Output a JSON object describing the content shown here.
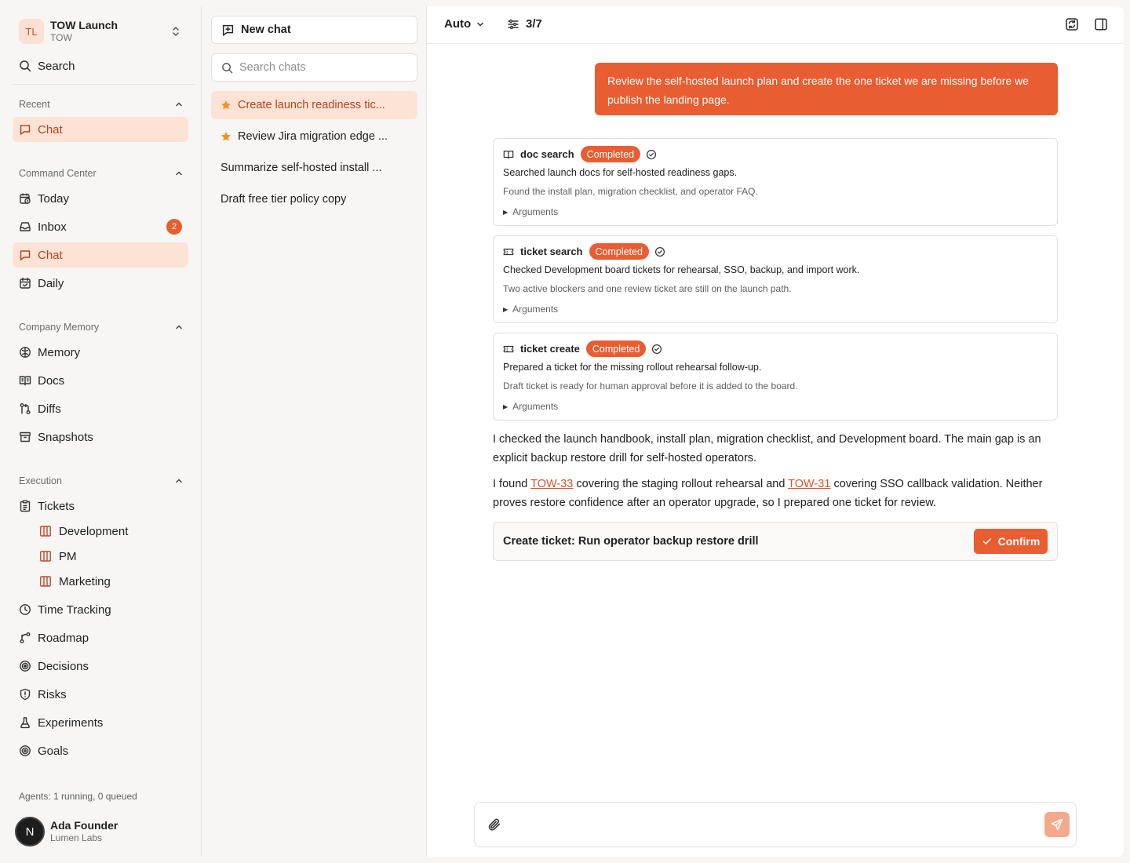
{
  "colors": {
    "accent": "#e85d31",
    "accent_soft": "#fde3d6",
    "accent_text": "#b2451d",
    "background": "#f7f6f5"
  },
  "workspace": {
    "initials": "TL",
    "name": "TOW Launch",
    "key": "TOW"
  },
  "sidebar": {
    "search_label": "Search",
    "sections": {
      "recent": {
        "title": "Recent",
        "items": [
          {
            "label": "Chat",
            "icon": "message-square-icon",
            "active": true
          }
        ]
      },
      "command_center": {
        "title": "Command Center",
        "items": [
          {
            "label": "Today",
            "icon": "calendar-clock-icon"
          },
          {
            "label": "Inbox",
            "icon": "inbox-icon",
            "badge": "2"
          },
          {
            "label": "Chat",
            "icon": "message-square-icon",
            "active": true
          },
          {
            "label": "Daily",
            "icon": "calendar-check-icon"
          }
        ]
      },
      "company_memory": {
        "title": "Company Memory",
        "items": [
          {
            "label": "Memory",
            "icon": "brain-icon"
          },
          {
            "label": "Docs",
            "icon": "book-open-icon"
          },
          {
            "label": "Diffs",
            "icon": "git-compare-icon"
          },
          {
            "label": "Snapshots",
            "icon": "archive-icon"
          }
        ]
      },
      "execution": {
        "title": "Execution",
        "items": [
          {
            "label": "Tickets",
            "icon": "clipboard-list-icon"
          },
          {
            "label": "Development",
            "icon": "board-icon",
            "sub": true
          },
          {
            "label": "PM",
            "icon": "board-icon",
            "sub": true
          },
          {
            "label": "Marketing",
            "icon": "board-icon",
            "sub": true
          },
          {
            "label": "Time Tracking",
            "icon": "clock-icon"
          },
          {
            "label": "Roadmap",
            "icon": "route-icon"
          },
          {
            "label": "Decisions",
            "icon": "target-icon"
          },
          {
            "label": "Risks",
            "icon": "shield-alert-icon"
          },
          {
            "label": "Experiments",
            "icon": "flask-icon"
          },
          {
            "label": "Goals",
            "icon": "goal-icon"
          }
        ]
      }
    },
    "agents_status": "Agents: 1 running, 0 queued",
    "user": {
      "initial": "N",
      "name": "Ada Founder",
      "org": "Lumen Labs"
    }
  },
  "chat_list": {
    "new_chat_label": "New chat",
    "search_placeholder": "Search chats",
    "conversations": [
      {
        "title": "Create launch readiness tic...",
        "starred": true,
        "active": true
      },
      {
        "title": "Review Jira migration edge ...",
        "starred": true,
        "active": false
      },
      {
        "title": "Summarize self-hosted install ...",
        "starred": false,
        "active": false
      },
      {
        "title": "Draft free tier policy copy",
        "starred": false,
        "active": false
      }
    ]
  },
  "main": {
    "model_label": "Auto",
    "steps_label": "3/7",
    "user_message": "Review the self-hosted launch plan and create the one ticket we are missing before we publish the landing page.",
    "tool_calls": [
      {
        "name": "doc search",
        "icon": "book-open-icon",
        "status": "Completed",
        "summary": "Searched launch docs for self-hosted readiness gaps.",
        "detail": "Found the install plan, migration checklist, and operator FAQ.",
        "args_label": "Arguments"
      },
      {
        "name": "ticket search",
        "icon": "ticket-icon",
        "status": "Completed",
        "summary": "Checked Development board tickets for rehearsal, SSO, backup, and import work.",
        "detail": "Two active blockers and one review ticket are still on the launch path.",
        "args_label": "Arguments"
      },
      {
        "name": "ticket create",
        "icon": "ticket-icon",
        "status": "Completed",
        "summary": "Prepared a ticket for the missing rollout rehearsal follow-up.",
        "detail": "Draft ticket is ready for human approval before it is added to the board.",
        "args_label": "Arguments"
      }
    ],
    "reply": {
      "p1": "I checked the launch handbook, install plan, migration checklist, and Development board. The main gap is an explicit backup restore drill for self-hosted operators.",
      "p2_a": "I found ",
      "link1": "TOW-33",
      "p2_b": " covering the staging rollout rehearsal and ",
      "link2": "TOW-31",
      "p2_c": " covering SSO callback validation. Neither proves restore confidence after an operator upgrade, so I prepared one ticket for review."
    },
    "confirm": {
      "title": "Create ticket: Run operator backup restore drill",
      "button_label": "Confirm"
    },
    "composer": {
      "value": "",
      "placeholder": ""
    }
  }
}
